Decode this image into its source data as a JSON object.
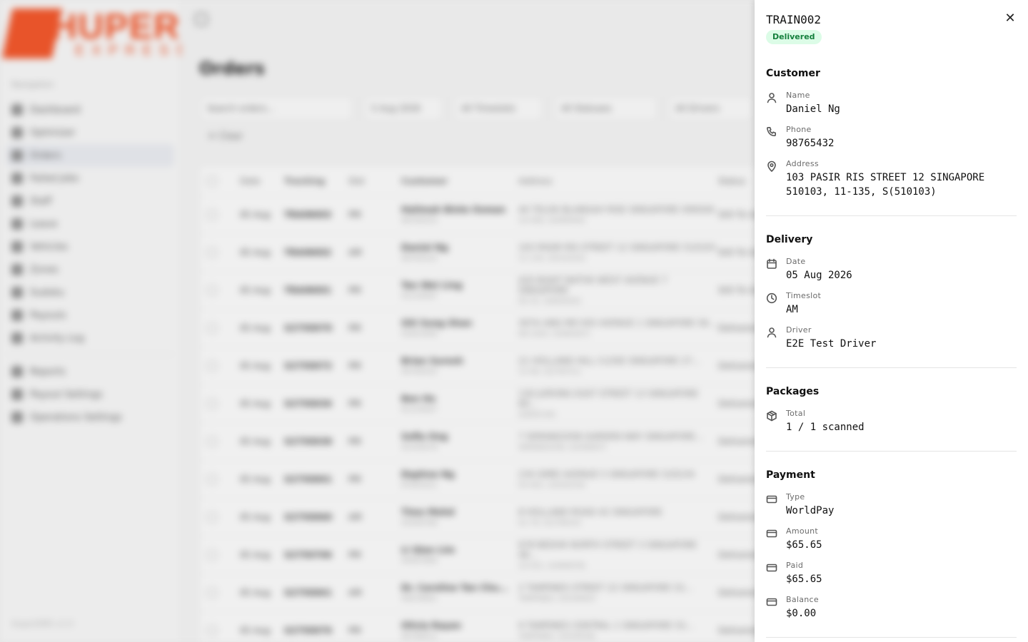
{
  "brand": {
    "name": "HUPER",
    "sub": "EXPRESS",
    "accent": "#e8542a"
  },
  "sidebar": {
    "heading": "Navigation",
    "items": [
      {
        "label": "Dashboard",
        "active": false
      },
      {
        "label": "Optimizer",
        "active": false
      },
      {
        "label": "Orders",
        "active": true
      },
      {
        "label": "Failed Jobs",
        "active": false
      },
      {
        "label": "Staff",
        "active": false
      },
      {
        "label": "Leave",
        "active": false
      },
      {
        "label": "Vehicles",
        "active": false
      },
      {
        "label": "Zones",
        "active": false
      },
      {
        "label": "Sudoku",
        "active": false
      },
      {
        "label": "Payouts",
        "active": false
      },
      {
        "label": "Activity Log",
        "active": false
      }
    ],
    "secondary_items": [
      {
        "label": "Reports"
      },
      {
        "label": "Payout Settings"
      },
      {
        "label": "Operations Settings"
      }
    ],
    "version": "HuperDMS v1.0"
  },
  "orders_page": {
    "title": "Orders",
    "search_placeholder": "Search orders...",
    "date_filter": "5 Aug 2026",
    "timeslot_filter": "All Timeslots",
    "status_filter": "All Statuses",
    "driver_filter": "All Drivers",
    "clear_label": "Clear",
    "columns": [
      "Date",
      "Tracking",
      "Slot",
      "Customer",
      "Address",
      "Status"
    ],
    "rows": [
      {
        "date": "05 Aug",
        "tracking": "TRAIN003",
        "slot": "PM",
        "customer": "Halimah Binte Osman",
        "phone": "98765433",
        "address": "40 TELOK BLANGAH RISE SINGAPORE 090040",
        "addr2": "10-456, S(090040)",
        "status": "Still To Go"
      },
      {
        "date": "05 Aug",
        "tracking": "TRAIN002",
        "slot": "AM",
        "customer": "Daniel Ng",
        "phone": "98765432",
        "address": "103 PASIR RIS STREET 12 SINGAPORE 510103",
        "addr2": "11-135, S(510103)",
        "status": "Still To Go"
      },
      {
        "date": "05 Aug",
        "tracking": "TRAIN001",
        "slot": "PM",
        "customer": "Tan Wei Ling",
        "phone": "91234567",
        "address": "420 BUKIT BATOK WEST AVENUE 7 SINGAPORE",
        "addr2": "05-32, S(650420)",
        "status": "Still To Go"
      },
      {
        "date": "05 Aug",
        "tracking": "S2750070",
        "slot": "PM",
        "customer": "Siti Sung Shan",
        "phone": "91823456",
        "address": "307A ANG MO KIO AVENUE 1 SINGAPORE 56...",
        "addr2": "08-1043, S(560307)",
        "status": "Delivered"
      },
      {
        "date": "05 Aug",
        "tracking": "S2750072",
        "slot": "PM",
        "customer": "Brian Suresh",
        "phone": "90765432",
        "address": "21 HOLLAND HILL CLOSE SINGAPORE 27...",
        "addr2": "12-06, S(278721)",
        "status": "Delivered"
      },
      {
        "date": "05 Aug",
        "tracking": "S2750036",
        "slot": "PM",
        "customer": "Ben Ho",
        "phone": "81234567",
        "address": "130 JURONG EAST STREET 13 SINGAPORE 60...",
        "addr2": "S(600130)",
        "status": "Delivered"
      },
      {
        "date": "05 Aug",
        "tracking": "S2750038",
        "slot": "PM",
        "customer": "Sofia Ong",
        "phone": "92345678",
        "address": "7 SERANGOON GARDEN WAY SINGAPORE...",
        "addr2": "SERANGOON, S(556007)",
        "status": "Delivered"
      },
      {
        "date": "05 Aug",
        "tracking": "S2750001",
        "slot": "PM",
        "customer": "Daphne Ng",
        "phone": "87654321",
        "address": "234 SIMEI AVENUE 5 SINGAPORE 520234",
        "addr2": "03-401, S(520234)",
        "status": "Delivered"
      },
      {
        "date": "05 Aug",
        "tracking": "S2750060",
        "slot": "AM",
        "customer": "Timo Mohd",
        "phone": "93456789",
        "address": "8 HOLLAND ROAD 42 SINGAPORE",
        "addr2": "01-79, S(276010)",
        "status": "Delivered"
      },
      {
        "date": "05 Aug",
        "tracking": "S2750706",
        "slot": "PM",
        "customer": "Li Qian Lim",
        "phone": "94567890",
        "address": "678 BEDOK NORTH STREET 3 SINGAPORE 46...",
        "addr2": "10-421, S(460678)",
        "status": "Delivered"
      },
      {
        "date": "05 Aug",
        "tracking": "S2750061",
        "slot": "AM",
        "customer": "Dr. Caroline Tan Chu...",
        "phone": "95678901",
        "address": "2 TAMPINES STREET 22 SINGAPORE 52...",
        "addr2": "TAMPINES, S(529002)",
        "status": "Delivered"
      },
      {
        "date": "05 Aug",
        "tracking": "S2750076",
        "slot": "PM",
        "customer": "Olivia Rayan",
        "phone": "96789012",
        "address": "9 TAMPINES CENTRAL 1 SINGAPORE 52...",
        "addr2": "TAMPINES, S(529536)",
        "status": "Delivered"
      }
    ]
  },
  "order_detail": {
    "tracking": "TRAIN002",
    "status": "Delivered",
    "status_bg": "#dcfce7",
    "status_fg": "#15803d",
    "customer": {
      "title": "Customer",
      "name_label": "Name",
      "name": "Daniel Ng",
      "phone_label": "Phone",
      "phone": "98765432",
      "address_label": "Address",
      "address": "103 PASIR RIS STREET 12 SINGAPORE 510103, 11-135, S(510103)"
    },
    "delivery": {
      "title": "Delivery",
      "date_label": "Date",
      "date": "05 Aug 2026",
      "timeslot_label": "Timeslot",
      "timeslot": "AM",
      "driver_label": "Driver",
      "driver": "E2E Test Driver"
    },
    "packages": {
      "title": "Packages",
      "total_label": "Total",
      "total": "1 / 1 scanned"
    },
    "payment": {
      "title": "Payment",
      "type_label": "Type",
      "type": "WorldPay",
      "amount_label": "Amount",
      "amount": "$65.65",
      "paid_label": "Paid",
      "paid": "$65.65",
      "balance_label": "Balance",
      "balance": "$0.00"
    }
  },
  "icons": {
    "close": "close-icon",
    "user": "user-icon",
    "phone": "phone-icon",
    "address": "map-pin-icon",
    "date": "calendar-icon",
    "timeslot": "clock-icon",
    "driver": "user-icon",
    "packages": "package-icon",
    "payment": "credit-card-icon"
  }
}
